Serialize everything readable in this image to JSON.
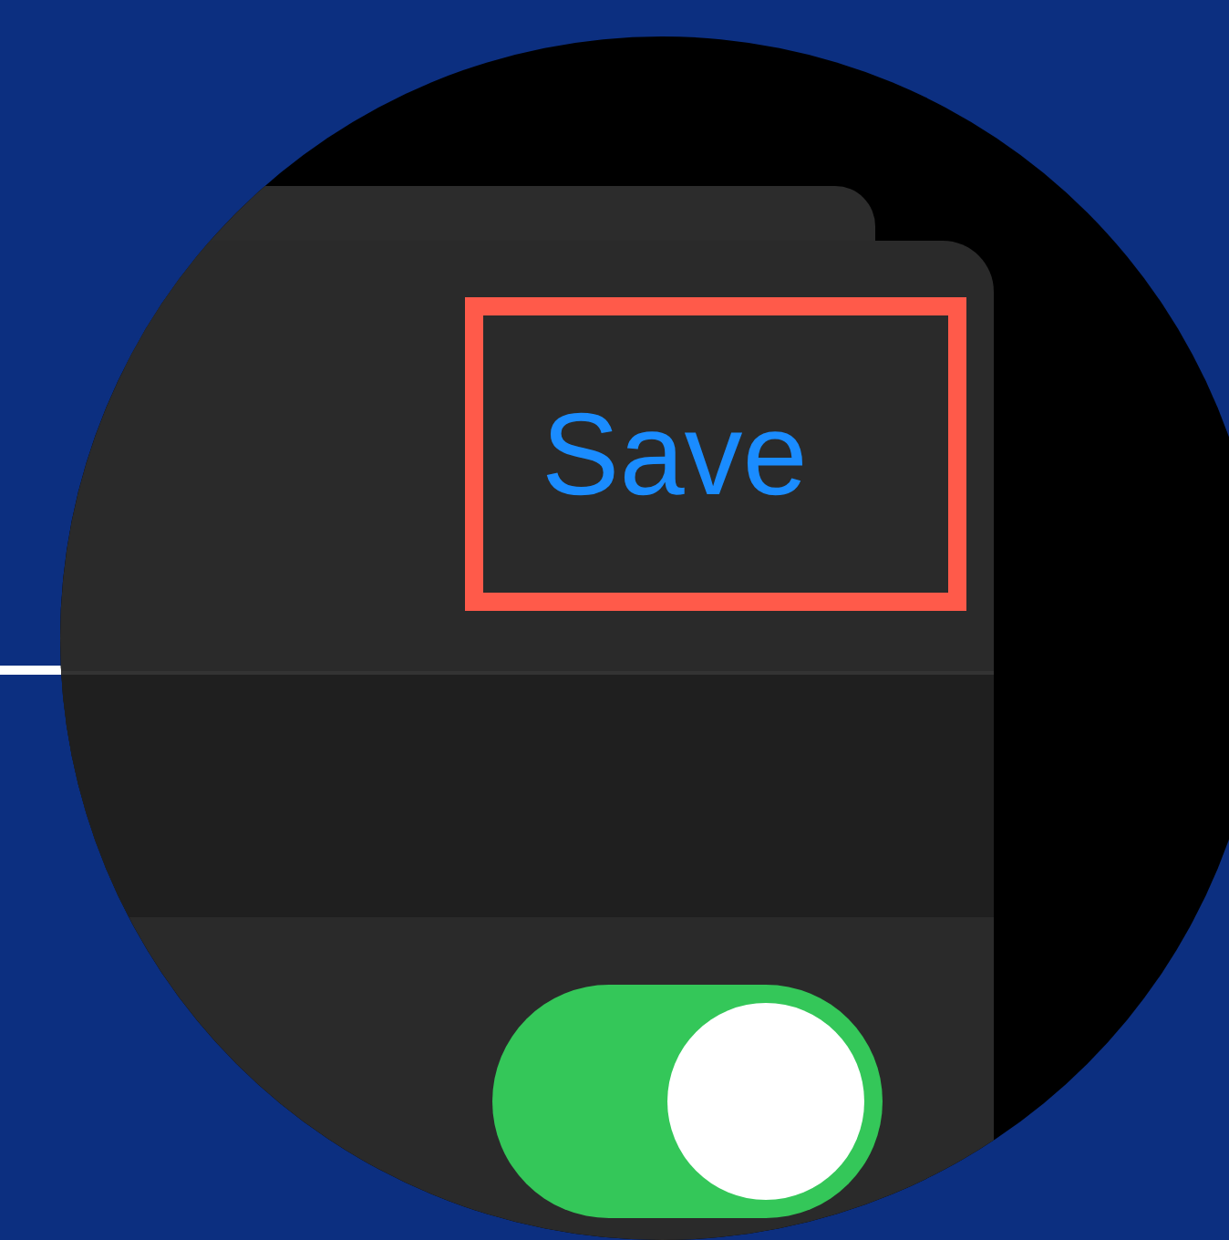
{
  "save_button": {
    "label": "Save",
    "highlighted": true
  },
  "toggle": {
    "on": true
  }
}
